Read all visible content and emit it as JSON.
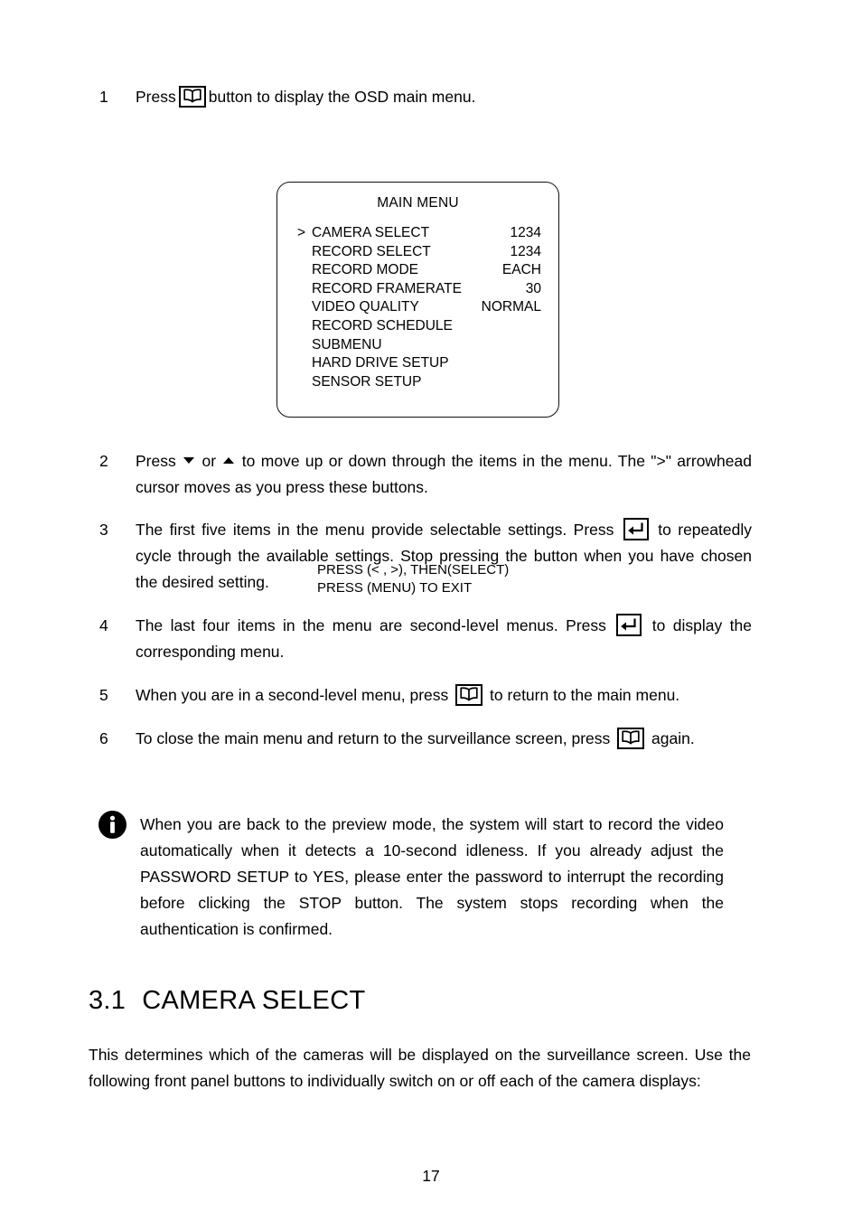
{
  "page": {
    "number": "17"
  },
  "steps": [
    {
      "num": "1",
      "text_before": "Press",
      "icon": "menu-book-icon",
      "text_after": "button to display the OSD main menu."
    },
    {
      "num": "2",
      "text_before": "Press",
      "icon_down": "triangle-down-icon",
      "text_middle": "or",
      "icon_up": "triangle-up-icon",
      "text_after": "to move up or down through the items in the menu. The \">\" arrowhead cursor moves as you press these buttons."
    },
    {
      "num": "3",
      "text_before": "The first five items in the menu provide selectable settings. Press",
      "icon": "enter-key-icon",
      "text_after": "to repeatedly cycle through the available settings. Stop pressing the button when you have chosen the desired setting."
    },
    {
      "num": "4",
      "text_before": "The last four items in the menu are second-level menus. Press",
      "icon": "enter-key-icon",
      "text_after": "to display the corresponding menu."
    },
    {
      "num": "5",
      "text_before": "When you are in a second-level menu, press",
      "icon": "menu-book-icon",
      "text_after": "to return to the main menu."
    },
    {
      "num": "6",
      "text_before": "To close the main menu and return to the surveillance screen, press",
      "icon": "menu-book-icon",
      "text_after": "again."
    }
  ],
  "osd_menu": {
    "title": "MAIN MENU",
    "cursor_symbol": ">",
    "items": [
      {
        "label": "CAMERA SELECT",
        "value": "1234",
        "selected": true
      },
      {
        "label": "RECORD SELECT",
        "value": "1234",
        "selected": false
      },
      {
        "label": "RECORD MODE",
        "value": "EACH",
        "selected": false
      },
      {
        "label": "RECORD FRAMERATE",
        "value": "30",
        "selected": false
      },
      {
        "label": "VIDEO QUALITY",
        "value": "NORMAL",
        "selected": false
      },
      {
        "label": "RECORD SCHEDULE",
        "value": "",
        "selected": false
      },
      {
        "label": "SUBMENU",
        "value": "",
        "selected": false
      },
      {
        "label": "HARD DRIVE SETUP",
        "value": "",
        "selected": false
      },
      {
        "label": "SENSOR SETUP",
        "value": "",
        "selected": false
      }
    ],
    "footer_line_1": "PRESS (< , >), THEN(SELECT)",
    "footer_line_2": "PRESS (MENU) TO EXIT"
  },
  "note": {
    "icon": "info-icon",
    "text": "When you are back to the preview mode, the system will start to record the video automatically when it detects a 10-second idleness. If you already adjust the PASSWORD SETUP to YES, please enter the password to interrupt the recording before clicking the STOP button. The system stops recording when the authentication is confirmed."
  },
  "section": {
    "number": "3.1",
    "title": "CAMERA SELECT",
    "paragraph": "This determines which of the cameras will be displayed on the surveillance screen. Use the following front panel buttons to individually switch on or off each of the camera displays:"
  }
}
